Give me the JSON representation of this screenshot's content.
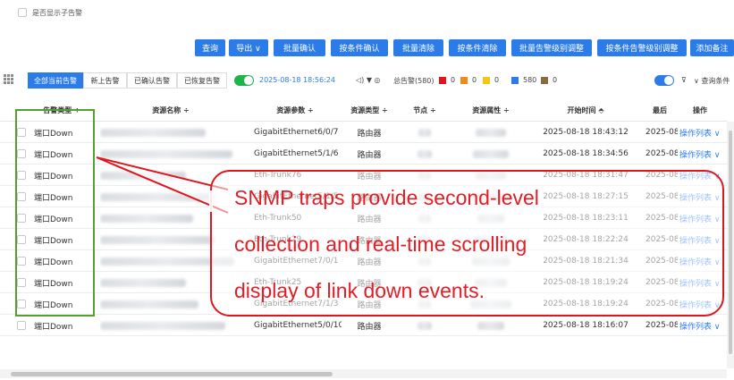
{
  "top": {
    "checkbox_label": "是否显示子告警"
  },
  "actions": {
    "query": "查询",
    "export": "导出 ∨",
    "batch_confirm": "批量确认",
    "confirm_by_condition": "按条件确认",
    "batch_clear": "批量清除",
    "clear_by_condition": "按条件清除",
    "batch_level_adjust": "批量告警级别调整",
    "level_adjust_by_condition": "按条件告警级别调整",
    "add_remark": "添加备注"
  },
  "filter": {
    "tabs": [
      "全部当前告警",
      "新上告警",
      "已确认告警",
      "已恢复告警"
    ],
    "datetime": "2025-08-18 18:56:24",
    "icons_text": "◁) ▼ ◎",
    "total_label": "总告警(580)",
    "severity_counts": [
      {
        "color": "#e3131b",
        "count": "0"
      },
      {
        "color": "#f08a1c",
        "count": "0"
      },
      {
        "color": "#f5c518",
        "count": "0"
      },
      {
        "color": "#2b7ce9",
        "count": "580"
      },
      {
        "color": "#8b6b3d",
        "count": "0"
      }
    ],
    "query_remark": "∨ 查询条件"
  },
  "table": {
    "headers": [
      "告警类型 ÷",
      "资源名称 ÷",
      "资源参数 ÷",
      "资源类型 ÷",
      "节点 ÷",
      "资源属性 ÷",
      "开始时间 ⬘",
      "最后",
      "操作"
    ],
    "rows": [
      {
        "type": "端口Down",
        "param": "GigabitEthernet6/0/7",
        "rtype": "路由器",
        "start": "2025-08-18 18:43:12",
        "last": "2025-08",
        "op": "操作列表 ∨"
      },
      {
        "type": "端口Down",
        "param": "GigabitEthernet5/1/6",
        "rtype": "路由器",
        "start": "2025-08-18 18:34:56",
        "last": "2025-08",
        "op": "操作列表 ∨"
      },
      {
        "type": "端口Down",
        "param": "Eth-Trunk76",
        "rtype": "路由器",
        "start": "2025-08-18 18:31:47",
        "last": "2025-08",
        "op": "操作列表 ∨"
      },
      {
        "type": "端口Down",
        "param": "GigabitEthernet5/1/5",
        "rtype": "路由器",
        "start": "2025-08-18 18:27:15",
        "last": "2025-08",
        "op": "操作列表 ∨"
      },
      {
        "type": "端口Down",
        "param": "Eth-Trunk50",
        "rtype": "路由器",
        "start": "2025-08-18 18:23:11",
        "last": "2025-08",
        "op": "操作列表 ∨"
      },
      {
        "type": "端口Down",
        "param": "Eth-Trunk29",
        "rtype": "路由器",
        "start": "2025-08-18 18:22:24",
        "last": "2025-08",
        "op": "操作列表 ∨"
      },
      {
        "type": "端口Down",
        "param": "GigabitEthernet7/0/1",
        "rtype": "路由器",
        "start": "2025-08-18 18:21:34",
        "last": "2025-08",
        "op": "操作列表 ∨"
      },
      {
        "type": "端口Down",
        "param": "Eth-Trunk25",
        "rtype": "路由器",
        "start": "2025-08-18 18:19:24",
        "last": "2025-08",
        "op": "操作列表 ∨"
      },
      {
        "type": "端口Down",
        "param": "GigabitEthernet7/1/3",
        "rtype": "路由器",
        "start": "2025-08-18 18:19:24",
        "last": "2025-08",
        "op": "操作列表 ∨"
      },
      {
        "type": "端口Down",
        "param": "GigabitEthernet5/0/10",
        "rtype": "路由器",
        "start": "2025-08-18 18:16:07",
        "last": "2025-08",
        "op": "操作列表 ∨"
      }
    ]
  },
  "callout": {
    "lines": [
      "SNMP traps provide second-level",
      "collection and real-time scrolling",
      "display of link down events."
    ]
  }
}
